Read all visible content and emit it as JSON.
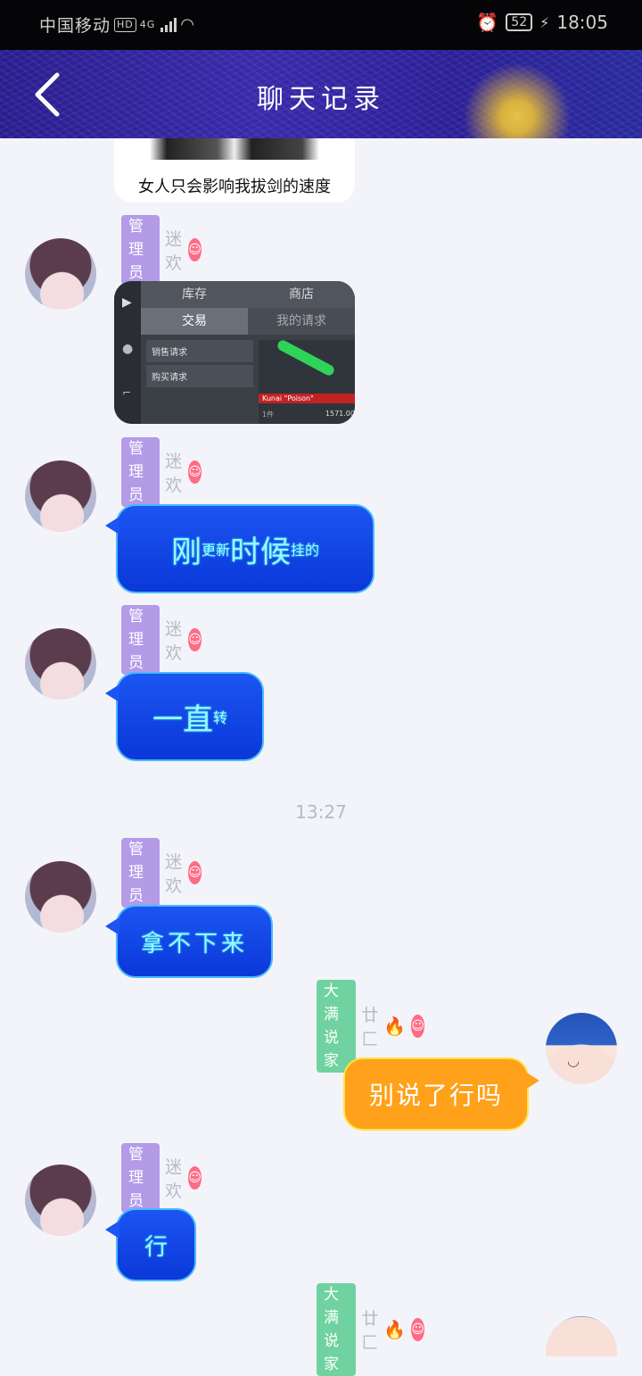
{
  "status_bar": {
    "carrier": "中国移动",
    "hd": "HD",
    "network": "4G",
    "battery": "52",
    "time": "18:05"
  },
  "header": {
    "title": "聊天记录"
  },
  "meme_caption": "女人只会影响我拔剑的速度",
  "admin": {
    "role": "管理员",
    "nick": "迷欢"
  },
  "user": {
    "role": "大满说家",
    "nick": "廿匚"
  },
  "shop_screenshot": {
    "tabs": [
      "库存",
      "商店"
    ],
    "subtabs": [
      "交易",
      "我的请求"
    ],
    "menu": [
      "销售请求",
      "购买请求"
    ],
    "item_name": "Kunai \"Poison\"",
    "item_count": "1件",
    "item_price": "1571.00"
  },
  "messages": {
    "m1_a": "刚",
    "m1_b": "更新",
    "m1_c": "时候",
    "m1_d": "挂的",
    "m2_a": "一直",
    "m2_b": "转",
    "timestamp": "13:27",
    "m3": "拿不下来",
    "m4": "别说了行吗",
    "m5": "行"
  }
}
